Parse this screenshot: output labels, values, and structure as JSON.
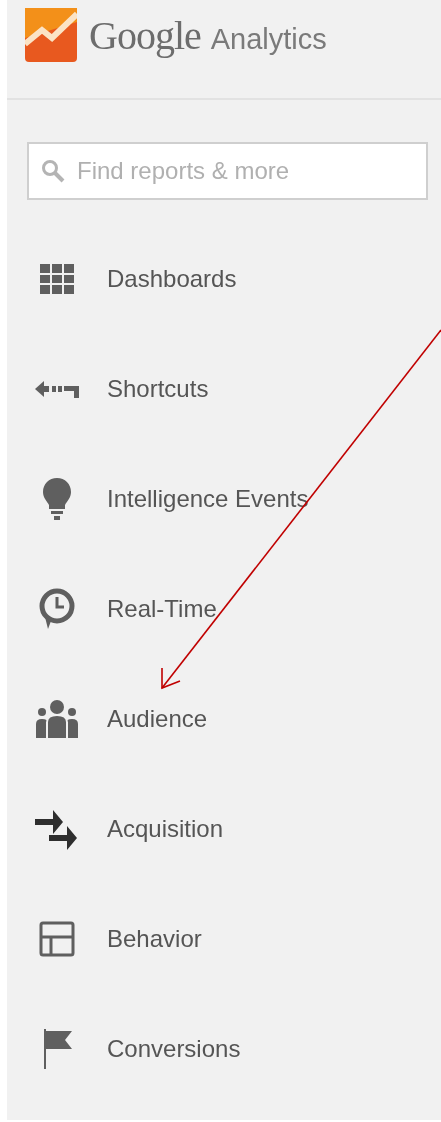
{
  "logo": {
    "brand": "Google",
    "product": "Analytics"
  },
  "search": {
    "placeholder": "Find reports & more"
  },
  "nav": [
    {
      "label": "Dashboards"
    },
    {
      "label": "Shortcuts"
    },
    {
      "label": "Intelligence Events"
    },
    {
      "label": "Real-Time"
    },
    {
      "label": "Audience"
    },
    {
      "label": "Acquisition"
    },
    {
      "label": "Behavior"
    },
    {
      "label": "Conversions"
    }
  ]
}
